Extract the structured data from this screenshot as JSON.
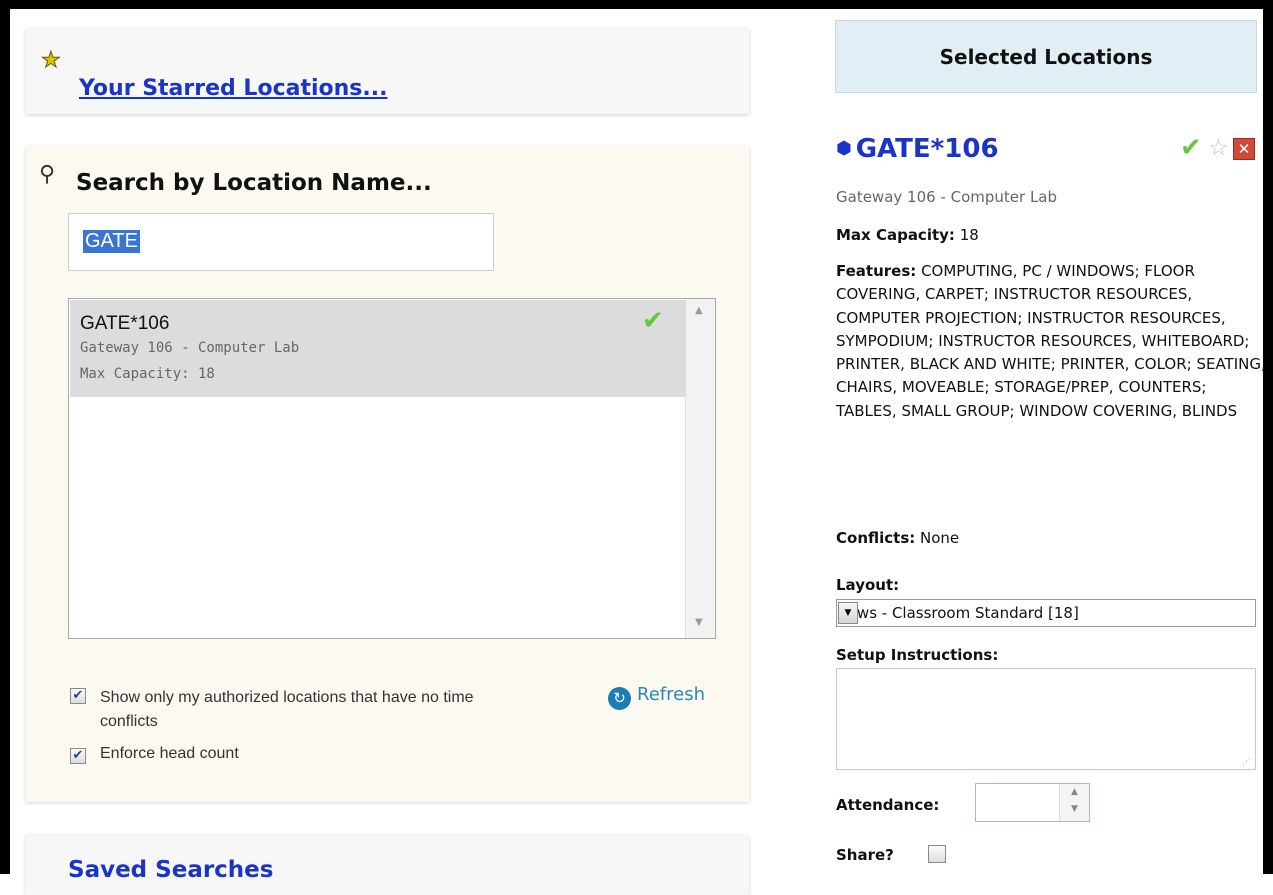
{
  "starred": {
    "link_label": "Your Starred Locations..."
  },
  "search": {
    "heading": "Search by Location Name...",
    "query": "GATE",
    "results": [
      {
        "name": "GATE*106",
        "description": "Gateway 106 - Computer Lab",
        "capacity": "Max Capacity: 18"
      }
    ],
    "option_authorized_label": "Show only my authorized locations that have no time conflicts",
    "option_authorized_checked": true,
    "option_headcount_label": "Enforce head count",
    "option_headcount_checked": true,
    "refresh_label": "Refresh"
  },
  "saved_searches": {
    "heading": "Saved Searches"
  },
  "selected": {
    "header": "Selected Locations",
    "location_name": "GATE*106",
    "description": "Gateway 106 - Computer Lab",
    "max_capacity_label": "Max Capacity:",
    "max_capacity_value": "18",
    "features_label": "Features:",
    "features_value": "COMPUTING, PC / WINDOWS; FLOOR COVERING, CARPET; INSTRUCTOR RESOURCES, COMPUTER PROJECTION; INSTRUCTOR RESOURCES, SYMPODIUM; INSTRUCTOR RESOURCES, WHITEBOARD; PRINTER, BLACK AND WHITE; PRINTER, COLOR; SEATING, CHAIRS, MOVEABLE; STORAGE/PREP, COUNTERS; TABLES, SMALL GROUP; WINDOW COVERING, BLINDS",
    "conflicts_label": "Conflicts:",
    "conflicts_value": "None",
    "layout_label": "Layout:",
    "layout_value": "Rows - Classroom Standard [18]",
    "setup_label": "Setup Instructions:",
    "setup_value": "",
    "attendance_label": "Attendance:",
    "attendance_value": "",
    "share_label": "Share?",
    "share_checked": false
  },
  "colors": {
    "link_blue": "#1a33c8",
    "check_green": "#69c63e",
    "remove_red": "#cf4a3a",
    "refresh_blue": "#2a87b8",
    "header_bg": "#e1eef6",
    "search_panel_bg": "#fbf9f0",
    "selection_bg": "#3875d7"
  },
  "icons": {
    "starred": "star-icon",
    "search": "magnifier-icon",
    "location": "cube-icon",
    "selected": "checkmark-icon",
    "favorite": "star-outline-icon",
    "remove": "close-icon",
    "refresh": "refresh-icon"
  }
}
